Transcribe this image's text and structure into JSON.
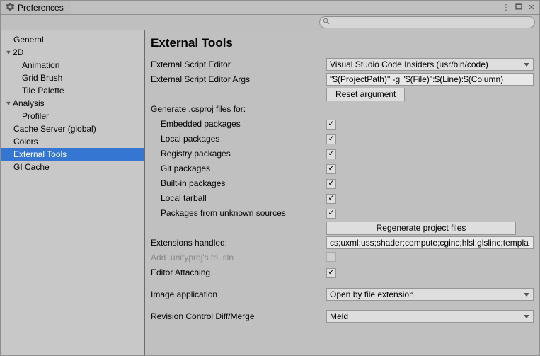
{
  "window": {
    "title": "Preferences"
  },
  "winctrl": {
    "menu": "⋮",
    "max": "🗖",
    "close": "✕"
  },
  "search": {
    "placeholder": ""
  },
  "sidebar": {
    "items": [
      {
        "label": "General",
        "depth": 0
      },
      {
        "label": "2D",
        "depth": 0,
        "fold": "▼"
      },
      {
        "label": "Animation",
        "depth": 2
      },
      {
        "label": "Grid Brush",
        "depth": 2
      },
      {
        "label": "Tile Palette",
        "depth": 2
      },
      {
        "label": "Analysis",
        "depth": 0,
        "fold": "▼"
      },
      {
        "label": "Profiler",
        "depth": 2
      },
      {
        "label": "Cache Server (global)",
        "depth": 1
      },
      {
        "label": "Colors",
        "depth": 1
      },
      {
        "label": "External Tools",
        "depth": 1,
        "selected": true
      },
      {
        "label": "GI Cache",
        "depth": 1
      }
    ]
  },
  "content": {
    "heading": "External Tools",
    "ext_editor_label": "External Script Editor",
    "ext_editor_value": "Visual Studio Code Insiders (usr/bin/code)",
    "ext_args_label": "External Script Editor Args",
    "ext_args_value": "\"$(ProjectPath)\" -g \"$(File)\":$(Line):$(Column)",
    "reset_btn": "Reset argument",
    "generate_label": "Generate .csproj files for:",
    "csproj": [
      {
        "label": "Embedded packages",
        "checked": true
      },
      {
        "label": "Local packages",
        "checked": true
      },
      {
        "label": "Registry packages",
        "checked": true
      },
      {
        "label": "Git packages",
        "checked": true
      },
      {
        "label": "Built-in packages",
        "checked": true
      },
      {
        "label": "Local tarball",
        "checked": true
      },
      {
        "label": "Packages from unknown sources",
        "checked": true
      }
    ],
    "regen_btn": "Regenerate project files",
    "ext_handled_label": "Extensions handled:",
    "ext_handled_value": "cs;uxml;uss;shader;compute;cginc;hlsl;glslinc;templa",
    "add_sln_label": "Add .unityproj's to .sln",
    "editor_attaching_label": "Editor Attaching",
    "image_app_label": "Image application",
    "image_app_value": "Open by file extension",
    "rev_label": "Revision Control Diff/Merge",
    "rev_value": "Meld"
  }
}
